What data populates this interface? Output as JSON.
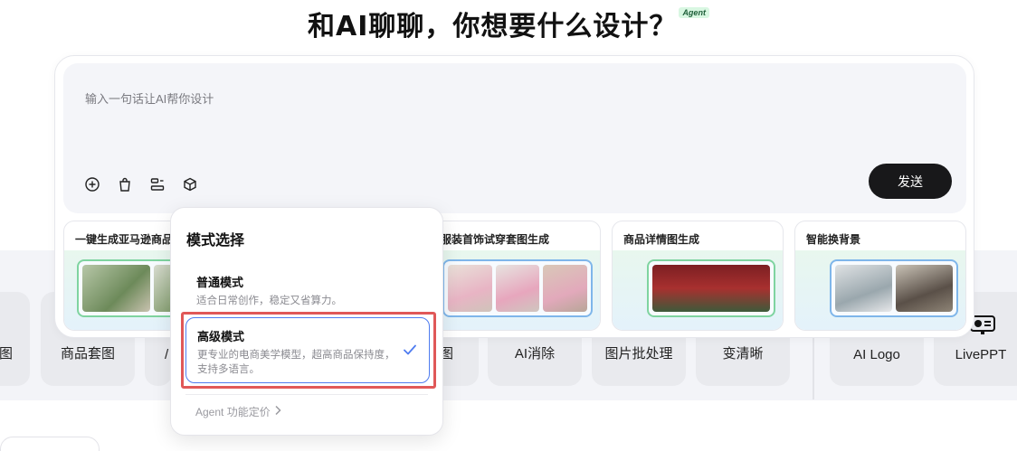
{
  "header": {
    "title": "和AI聊聊，你想要什么设计？",
    "badge": "Agent"
  },
  "composer": {
    "placeholder": "输入一句话让AI帮你设计",
    "send_label": "发送",
    "tools": [
      "add-icon",
      "bag-icon",
      "layout-icon",
      "cube-icon"
    ]
  },
  "feature_cards": [
    {
      "title": "一键生成亚马逊商品"
    },
    {
      "title": "服装首饰试穿套图生成"
    },
    {
      "title": "商品详情图生成"
    },
    {
      "title": "智能换背景"
    }
  ],
  "tools_row": [
    {
      "label": "图"
    },
    {
      "label": "商品套图"
    },
    {
      "label": "/"
    },
    {
      "label": "图"
    },
    {
      "label": "AI消除"
    },
    {
      "label": "图片批处理"
    },
    {
      "label": "变清晰"
    },
    {
      "label": "AI Logo"
    },
    {
      "label": "LivePPT"
    }
  ],
  "mode_menu": {
    "title": "模式选择",
    "options": [
      {
        "title": "普通模式",
        "desc": "适合日常创作，稳定又省算力。",
        "selected": false
      },
      {
        "title": "高级模式",
        "desc": "更专业的电商美学模型，超高商品保持度，支持多语言。",
        "selected": true
      }
    ],
    "pricing_link": "Agent 功能定价"
  },
  "colors": {
    "accent": "#4f7cf0",
    "highlight": "#e05858",
    "send_bg": "#18181a"
  }
}
